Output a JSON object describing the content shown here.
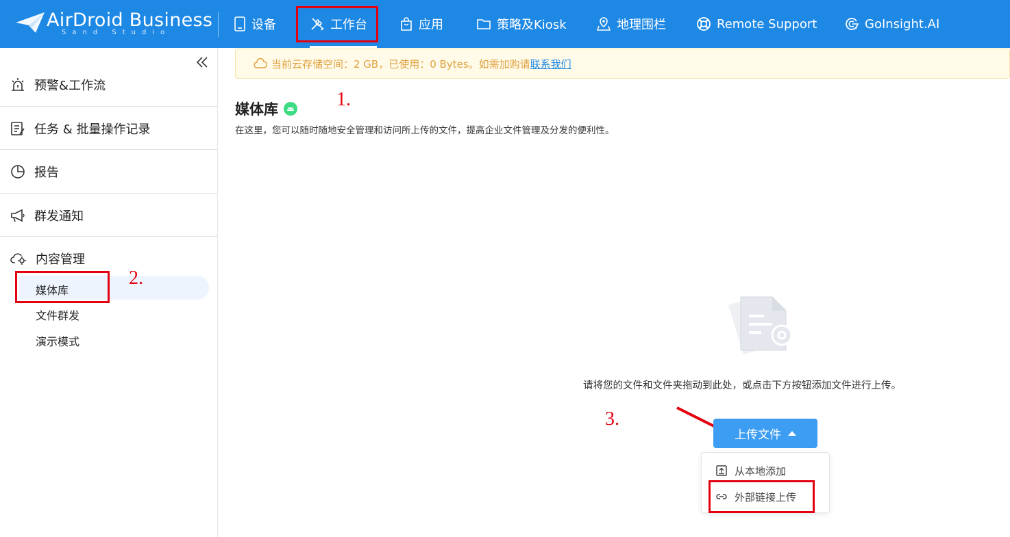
{
  "app": {
    "logo_text": "AirDroid Business",
    "logo_sub": "Sand Studio"
  },
  "nav": {
    "items": [
      {
        "label": "设备",
        "icon": "tablet-icon"
      },
      {
        "label": "工作台",
        "icon": "tools-icon",
        "active": true
      },
      {
        "label": "应用",
        "icon": "bag-icon"
      },
      {
        "label": "策略及Kiosk",
        "icon": "folder-icon"
      },
      {
        "label": "地理围栏",
        "icon": "map-pin-icon"
      },
      {
        "label": "Remote Support",
        "icon": "lifebuoy-icon"
      },
      {
        "label": "GoInsight.AI",
        "icon": "goinsight-icon"
      }
    ]
  },
  "sidebar": {
    "items": [
      {
        "label": "预警&工作流",
        "icon": "alarm-icon"
      },
      {
        "label": "任务 & 批量操作记录",
        "icon": "task-list-icon"
      },
      {
        "label": "报告",
        "icon": "pie-chart-icon"
      },
      {
        "label": "群发通知",
        "icon": "megaphone-icon"
      },
      {
        "label": "内容管理",
        "icon": "cloud-gear-icon"
      }
    ],
    "sub_items": [
      {
        "label": "媒体库",
        "active": true
      },
      {
        "label": "文件群发"
      },
      {
        "label": "演示模式"
      }
    ]
  },
  "banner": {
    "text": "当前云存储空间：2 GB，已使用：0 Bytes。如需加购请",
    "link": "联系我们"
  },
  "page": {
    "title": "媒体库",
    "description": "在这里，您可以随时随地安全管理和访问所上传的文件，提高企业文件管理及分发的便利性。"
  },
  "empty": {
    "text": "请将您的文件和文件夹拖动到此处，或点击下方按钮添加文件进行上传。"
  },
  "upload": {
    "button_label": "上传文件",
    "menu": [
      {
        "label": "从本地添加",
        "icon": "upload-box-icon"
      },
      {
        "label": "外部链接上传",
        "icon": "link-icon"
      }
    ]
  },
  "annotations": {
    "step1": "1.",
    "step2": "2.",
    "step3": "3."
  },
  "colors": {
    "primary": "#1e88e5",
    "button": "#3d9df2",
    "annotation": "#e5000f",
    "banner_text": "#e0a040",
    "android_badge": "#3ddc84"
  }
}
